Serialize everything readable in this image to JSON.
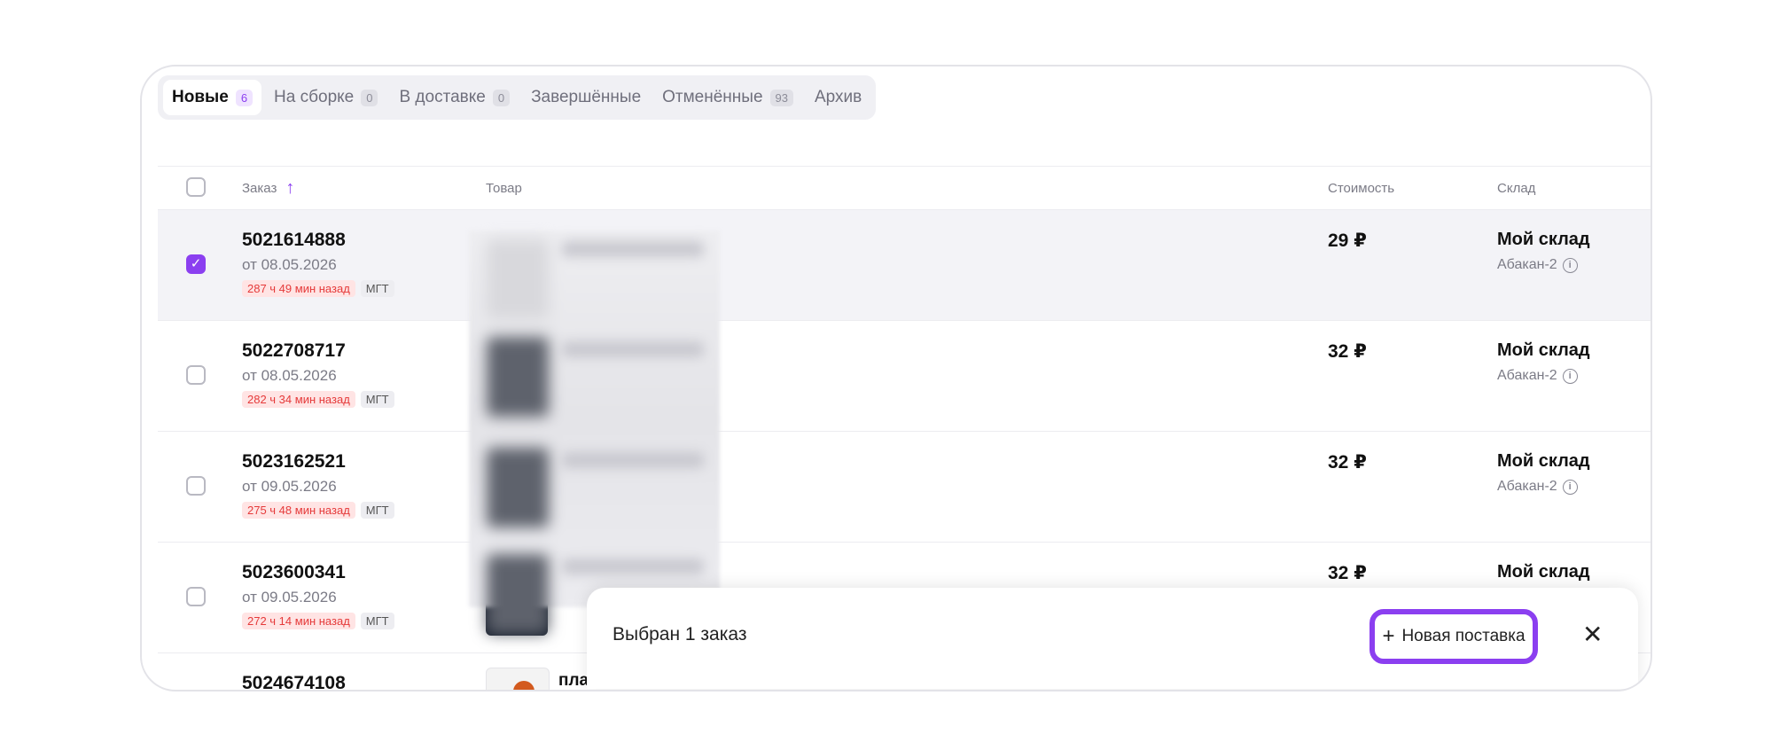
{
  "tabs": [
    {
      "label": "Новые",
      "count": "6"
    },
    {
      "label": "На сборке",
      "count": "0"
    },
    {
      "label": "В доставке",
      "count": "0"
    },
    {
      "label": "Завершённые",
      "count": ""
    },
    {
      "label": "Отменённые",
      "count": "93"
    },
    {
      "label": "Архив",
      "count": ""
    }
  ],
  "table": {
    "headers": {
      "order": "Заказ",
      "product": "Товар",
      "price": "Стоимость",
      "warehouse": "Склад"
    },
    "rows": [
      {
        "order": "5021614888",
        "date": "от 08.05.2026",
        "age": "287 ч 49 мин назад",
        "badge": "МГТ",
        "price": "29 ₽",
        "warehouse": "Мой склад",
        "city": "Абакан-2",
        "selected": true
      },
      {
        "order": "5022708717",
        "date": "от 08.05.2026",
        "age": "282 ч 34 мин назад",
        "badge": "МГТ",
        "price": "32 ₽",
        "warehouse": "Мой склад",
        "city": "Абакан-2",
        "selected": false
      },
      {
        "order": "5023162521",
        "date": "от 09.05.2026",
        "age": "275 ч 48 мин назад",
        "badge": "МГТ",
        "price": "32 ₽",
        "warehouse": "Мой склад",
        "city": "Абакан-2",
        "selected": false
      },
      {
        "order": "5023600341",
        "date": "от 09.05.2026",
        "age": "272 ч 14 мин назад",
        "badge": "МГТ",
        "price": "32 ₽",
        "warehouse": "Мой склад",
        "city": "",
        "selected": false
      },
      {
        "order": "5024674108",
        "product": "платья",
        "price": "",
        "warehouse": "",
        "selected": false
      }
    ]
  },
  "selection_bar": {
    "text": "Выбран 1 заказ",
    "new_shipment_label": "Новая поставка"
  },
  "colors": {
    "accent": "#8b3ff0",
    "age_tag_text": "#e53a3a",
    "age_tag_bg": "#ffe4e4"
  },
  "icons": {
    "sort": "arrow-up-icon",
    "info": "info-icon",
    "plus": "plus-icon",
    "close": "close-icon",
    "check": "check-icon"
  }
}
